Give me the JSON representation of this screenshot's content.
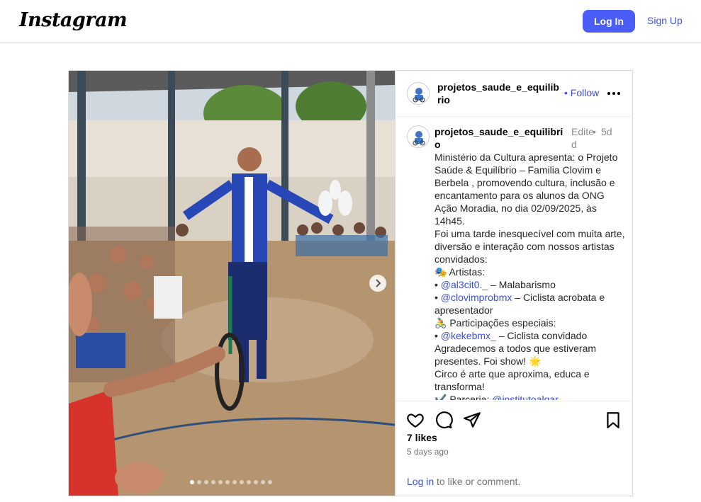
{
  "nav": {
    "logo": "Instagram",
    "login_label": "Log In",
    "signup_label": "Sign Up"
  },
  "post": {
    "username": "projetos_saude_e_equilibrio",
    "follow_label": "Follow",
    "follow_separator": "•",
    "comment": {
      "username": "projetos_saude_e_equilibrio",
      "edited": "Edited",
      "separator": "•",
      "time": "5d",
      "lines": [
        {
          "text": "Ministério da Cultura apresenta: o Projeto Saúde & Equilíbrio – Familia Clovim e Berbela , promovendo cultura, inclusão e encantamento para os alunos da ONG Ação Moradia, no dia 02/09/2025, às 14h45."
        },
        {
          "text": "Foi uma tarde inesquecível com muita arte, diversão e interação com nossos artistas convidados:"
        },
        {
          "text": "🎭 Artistas:"
        },
        {
          "prefix": "• ",
          "mention": "@al3cit0._",
          "text": " – Malabarismo"
        },
        {
          "prefix": "• ",
          "mention": "@clovimprobmx",
          "text": " – Ciclista acrobata e apresentador"
        },
        {
          "text": "🚴 Participações especiais:"
        },
        {
          "prefix": "• ",
          "mention": "@kekebmx_",
          "text": " – Ciclista convidado"
        },
        {
          "text": "Agradecemos a todos que estiveram presentes. Foi show! 🌟"
        },
        {
          "text": "Circo é arte que aproxima, educa e transforma!"
        },
        {
          "prefix": "✔️ Parceria: ",
          "mention": "@institutoalgar",
          "text": ""
        }
      ]
    },
    "likes": "7 likes",
    "date": "5 days ago",
    "login_prompt": {
      "link": "Log in",
      "rest": " to like or comment."
    },
    "carousel": {
      "count": 12,
      "active_index": 0
    }
  },
  "icons": [
    "heart-icon",
    "comment-icon",
    "share-icon",
    "bookmark-icon",
    "more-icon",
    "chevron-right-icon"
  ],
  "colors": {
    "accent": "#4a5df9",
    "link": "#3b4fe0",
    "muted": "#737373",
    "border": "#dbdbdb"
  }
}
